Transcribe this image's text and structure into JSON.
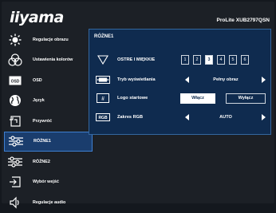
{
  "brand": {
    "logo": "iiyama",
    "model": "ProLite XUB2797QSN"
  },
  "sidebar": {
    "items": [
      {
        "label": "Regulacje obrazu",
        "icon": "brightness-icon"
      },
      {
        "label": "Ustawienia kolorów",
        "icon": "color-palette-icon"
      },
      {
        "label": "OSD",
        "icon": "osd-icon"
      },
      {
        "label": "Język",
        "icon": "globe-icon"
      },
      {
        "label": "Przywróć",
        "icon": "reset-icon"
      },
      {
        "label": "RÓŻNE1",
        "icon": "sliders-icon"
      },
      {
        "label": "RÓŻNE2",
        "icon": "sliders-icon"
      },
      {
        "label": "Wybór wejść",
        "icon": "input-icon"
      },
      {
        "label": "Regulacje audio",
        "icon": "speaker-icon"
      }
    ],
    "active": "RÓŻNE1"
  },
  "panel": {
    "title": "RÓŻNE1",
    "sharpness": {
      "label": "OSTRE I MIĘKKIE",
      "options": [
        "1",
        "2",
        "3",
        "4",
        "5",
        "6"
      ],
      "selected": "3"
    },
    "display_mode": {
      "label": "Tryb wyświetlania",
      "value": "Pełny obraz"
    },
    "boot_logo": {
      "label": "Logo startowe",
      "on_label": "Włącz",
      "off_label": "Wyłącz",
      "selected": "Włącz"
    },
    "rgb_range": {
      "label": "Zakres RGB",
      "icon_text": "RGB",
      "value": "AUTO"
    }
  }
}
